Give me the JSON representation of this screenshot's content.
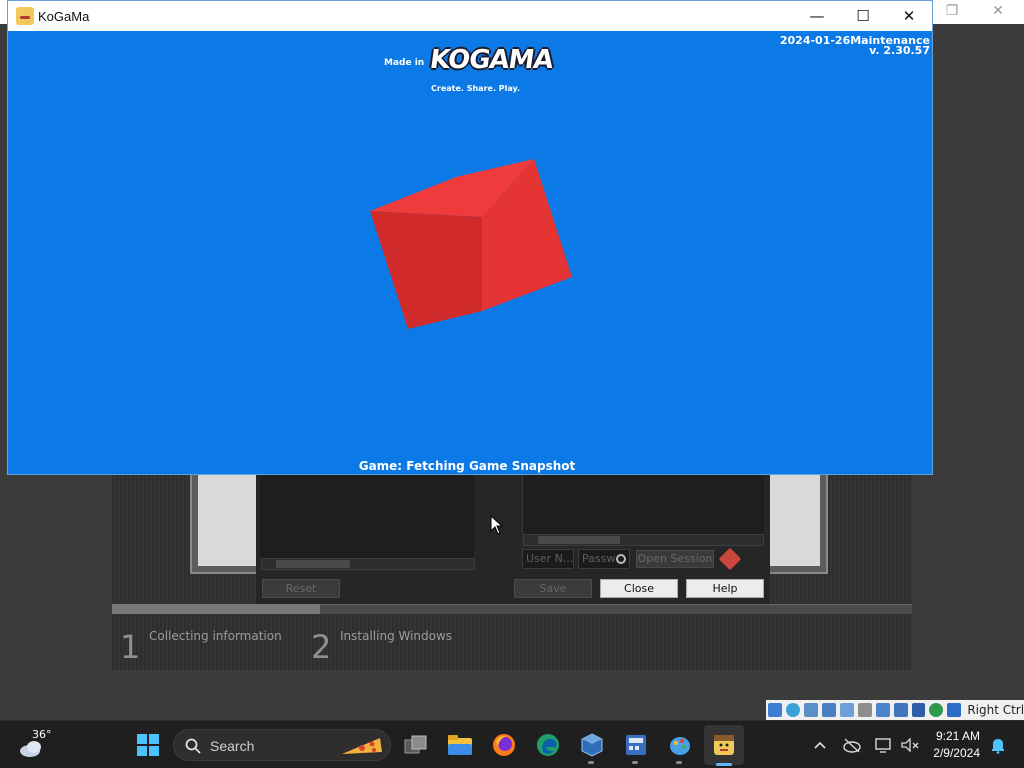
{
  "kogama_window": {
    "title": "KoGaMa",
    "minimize_glyph": "—",
    "maximize_glyph": "☐",
    "close_glyph": "✕",
    "made_in": "Made in",
    "logo_text": "KOGAMA",
    "tagline": "Create. Share. Play.",
    "version_date": "2024-01-26Maintenance",
    "version_number": "v. 2.30.57",
    "status_text": "Game: Fetching Game Snapshot",
    "background_color": "#0b7ae6",
    "cube_color": "#e03232"
  },
  "host_window": {
    "restore_glyph": "❐",
    "close_glyph": "✕"
  },
  "vbox_panel": {
    "username_placeholder": "User N...",
    "password_placeholder": "Passw",
    "open_session_label": "Open Session",
    "reset_label": "Reset",
    "save_label": "Save",
    "close_label": "Close",
    "help_label": "Help"
  },
  "setup_steps": [
    {
      "number": "1",
      "label": "Collecting information"
    },
    {
      "number": "2",
      "label": "Installing Windows"
    }
  ],
  "vbox_status": {
    "host_key": "Right Ctrl"
  },
  "taskbar": {
    "weather_temp": "36°",
    "search_label": "Search",
    "time": "9:21 AM",
    "date": "2/9/2024",
    "pinned_icons": [
      "windows-start-icon",
      "task-view-icon",
      "file-explorer-icon",
      "firefox-icon",
      "edge-icon",
      "virtualbox-icon",
      "calculator-icon",
      "paint-icon",
      "kogama-icon"
    ],
    "tray_icons": [
      "chevron-up-icon",
      "cloud-offline-icon",
      "display-icon",
      "volume-muted-icon",
      "notification-bell-icon"
    ]
  }
}
